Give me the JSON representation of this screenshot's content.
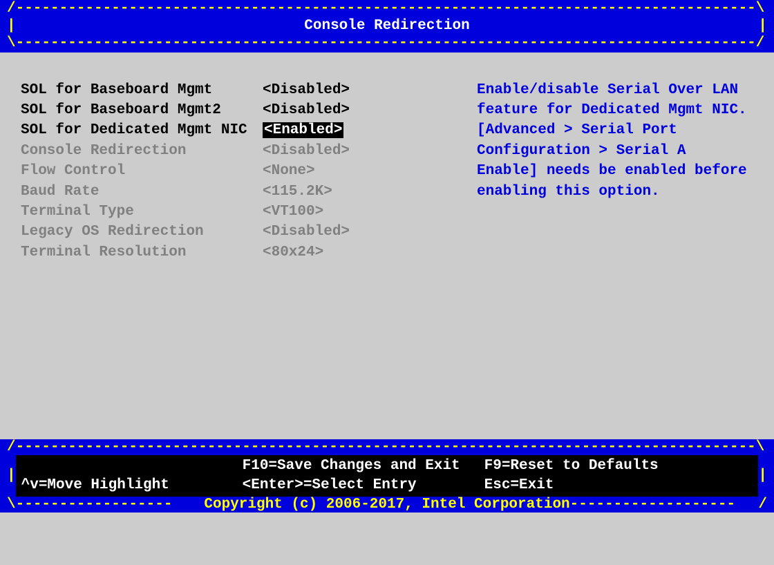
{
  "header": {
    "title": "Console Redirection"
  },
  "settings": [
    {
      "label": "SOL for Baseboard Mgmt",
      "value": "<Disabled>",
      "state": "active",
      "selected": false
    },
    {
      "label": "SOL for Baseboard Mgmt2",
      "value": "<Disabled>",
      "state": "active",
      "selected": false
    },
    {
      "label": "SOL for Dedicated Mgmt NIC",
      "value": "<Enabled>",
      "state": "active",
      "selected": true
    },
    {
      "label": "Console Redirection",
      "value": "<Disabled>",
      "state": "disabled",
      "selected": false
    },
    {
      "label": "Flow Control",
      "value": "<None>",
      "state": "disabled",
      "selected": false
    },
    {
      "label": "Baud Rate",
      "value": "<115.2K>",
      "state": "disabled",
      "selected": false
    },
    {
      "label": "Terminal Type",
      "value": "<VT100>",
      "state": "disabled",
      "selected": false
    },
    {
      "label": "Legacy OS Redirection",
      "value": "<Disabled>",
      "state": "disabled",
      "selected": false
    },
    {
      "label": "Terminal Resolution",
      "value": "<80x24>",
      "state": "disabled",
      "selected": false
    }
  ],
  "help_text": "Enable/disable Serial Over LAN feature for Dedicated Mgmt NIC. [Advanced > Serial Port Configuration > Serial A Enable] needs be enabled before enabling this option.",
  "footer": {
    "r1c1": "",
    "r1c2": "F10=Save Changes and Exit",
    "r1c3": "F9=Reset to Defaults",
    "r2c1": "^v=Move Highlight",
    "r2c2": "<Enter>=Select Entry",
    "r2c3": "Esc=Exit",
    "copyright": "Copyright (c) 2006-2017, Intel Corporation"
  }
}
